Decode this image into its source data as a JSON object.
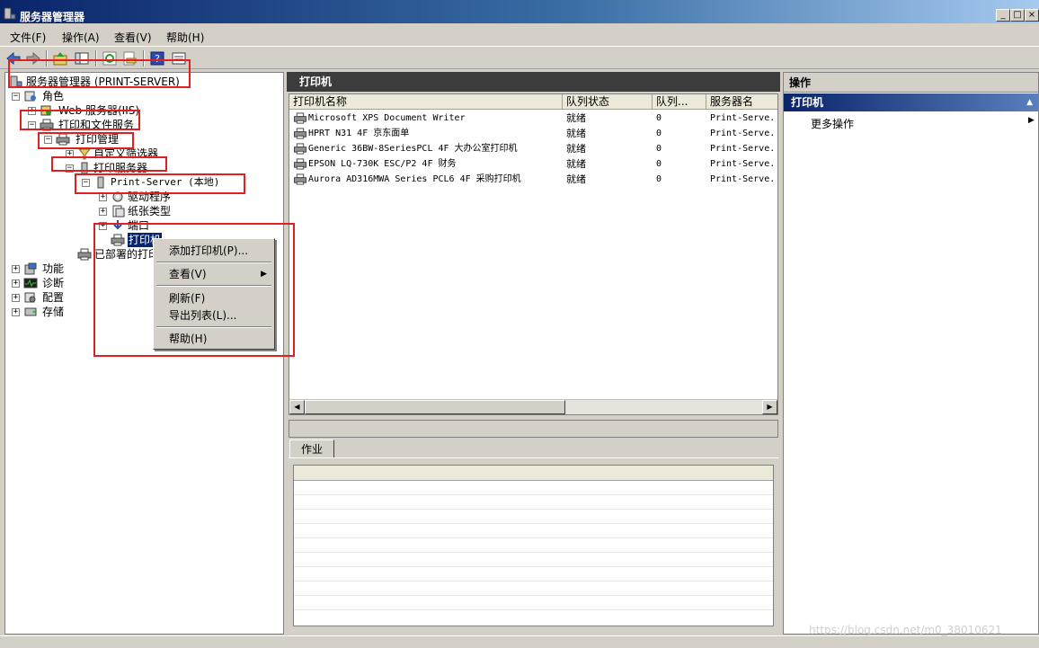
{
  "window": {
    "title": "服务器管理器",
    "controls": {
      "minimize": "_",
      "maximize": "□",
      "close": "×"
    }
  },
  "menu": [
    "文件(F)",
    "操作(A)",
    "查看(V)",
    "帮助(H)"
  ],
  "toolbar": {
    "icons": [
      "back-arrow-icon",
      "forward-arrow-icon",
      "up-folder-icon",
      "show-hide-tree-icon",
      "refresh-icon",
      "export-icon",
      "help-icon",
      "properties-icon"
    ]
  },
  "tree": {
    "root": "服务器管理器 (PRINT-SERVER)",
    "roles": "角色",
    "web_server": "Web 服务器(IIS)",
    "print_file_services": "打印和文件服务",
    "print_management": "打印管理",
    "custom_filters": "自定义筛选器",
    "print_servers": "打印服务器",
    "print_server_local": "Print-Server (本地)",
    "drivers": "驱动程序",
    "forms": "纸张类型",
    "ports": "端口",
    "printers": "打印机",
    "deployed_printers": "已部署的打印机",
    "features": "功能",
    "diagnostics": "诊断",
    "configuration": "配置",
    "storage": "存储"
  },
  "center": {
    "header": "打印机",
    "columns": [
      "打印机名称",
      "队列状态",
      "队列...",
      "服务器名"
    ],
    "printers": [
      {
        "name": "Microsoft XPS Document Writer",
        "status": "就绪",
        "jobs": "0",
        "server": "Print-Serve..."
      },
      {
        "name": "HPRT N31 4F 京东面单",
        "status": "就绪",
        "jobs": "0",
        "server": "Print-Serve..."
      },
      {
        "name": "Generic 36BW-8SeriesPCL 4F 大办公室打印机",
        "status": "就绪",
        "jobs": "0",
        "server": "Print-Serve..."
      },
      {
        "name": "EPSON LQ-730K ESC/P2 4F 财务",
        "status": "就绪",
        "jobs": "0",
        "server": "Print-Serve..."
      },
      {
        "name": "Aurora AD316MWA Series PCL6 4F 采购打印机",
        "status": "就绪",
        "jobs": "0",
        "server": "Print-Serve..."
      }
    ],
    "jobs_tab": "作业"
  },
  "actions": {
    "header": "操作",
    "section": "打印机",
    "more": "更多操作"
  },
  "context_menu": {
    "add_printer": "添加打印机(P)...",
    "view": "查看(V)",
    "refresh": "刷新(F)",
    "export_list": "导出列表(L)...",
    "help": "帮助(H)"
  },
  "watermark": "https://blog.csdn.net/m0_38010621",
  "colors": {
    "title_bar": "#0a246a",
    "selection": "#0a246a",
    "pane_header": "#3c3c3c",
    "annotation_red": "#e02020"
  }
}
